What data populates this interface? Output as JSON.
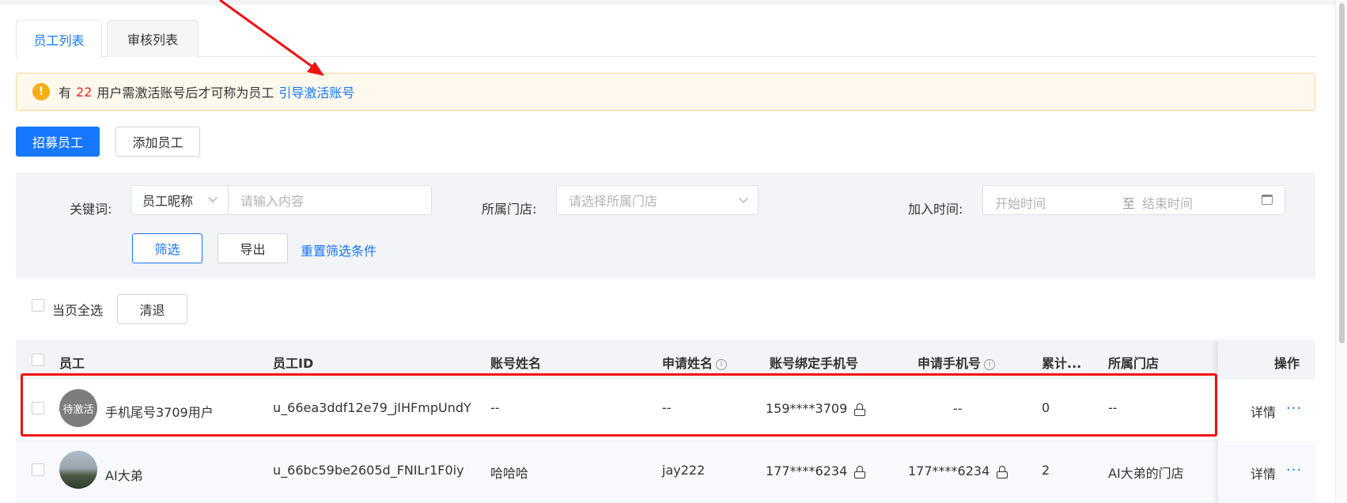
{
  "tabs": [
    {
      "label": "员工列表",
      "active": true
    },
    {
      "label": "审核列表",
      "active": false
    }
  ],
  "notice": {
    "prefix": "有",
    "count": "22",
    "suffix": "用户需激活账号后才可称为员工",
    "link": "引导激活账号",
    "icon": "warning-icon"
  },
  "actions": {
    "recruit": "招募员工",
    "add": "添加员工"
  },
  "filter": {
    "keyword_label": "关键词:",
    "keyword_type": "员工昵称",
    "keyword_placeholder": "请输入内容",
    "store_label": "所属门店:",
    "store_placeholder": "请选择所属门店",
    "join_label": "加入时间:",
    "start_placeholder": "开始时间",
    "range_sep": "至",
    "end_placeholder": "结束时间",
    "filter_button": "筛选",
    "export_button": "导出",
    "reset_link": "重置筛选条件"
  },
  "bulk": {
    "select_all": "当页全选",
    "clear_button": "清退"
  },
  "table": {
    "columns": [
      "员工",
      "员工ID",
      "账号姓名",
      "申请姓名",
      "账号绑定手机号",
      "申请手机号",
      "累计...",
      "所属门店",
      "操作"
    ],
    "rows": [
      {
        "avatar_text": "待激活",
        "name": "手机尾号3709用户",
        "id": "u_66ea3ddf12e79_jIHFmpUndY",
        "account_name": "--",
        "apply_name": "--",
        "bound_phone": "159****3709",
        "apply_phone": "--",
        "total": "0",
        "store": "--",
        "detail": "详情",
        "more": "···"
      },
      {
        "avatar_text": "",
        "name": "AI大弟",
        "id": "u_66bc59be2605d_FNILr1F0iy",
        "account_name": "哈哈哈",
        "apply_name": "jay222",
        "bound_phone": "177****6234",
        "apply_phone": "177****6234",
        "total": "2",
        "store": "AI大弟的门店",
        "detail": "详情",
        "more": "···"
      }
    ]
  },
  "colors": {
    "primary": "#1677ff",
    "warning": "#faad14",
    "danger": "#f5222d",
    "annotation": "#f01010"
  }
}
